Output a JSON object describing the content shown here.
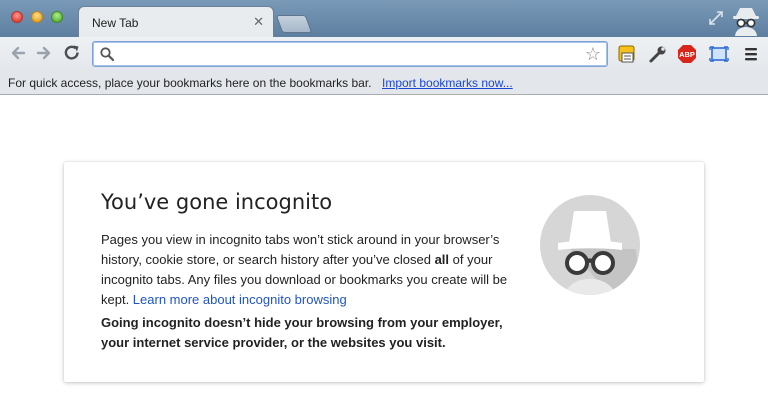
{
  "browser": {
    "tab": {
      "title": "New Tab",
      "close_glyph": "✕"
    },
    "window_controls": [
      "close",
      "minimize",
      "maximize"
    ],
    "icons": {
      "back": "back-arrow-icon",
      "forward": "forward-arrow-icon",
      "reload": "reload-icon",
      "search": "search-icon",
      "star": "bookmark-star-icon",
      "extensions": [
        "rss-extension-icon",
        "wrench-extension-icon",
        "adblock-plus-icon",
        "screenshot-extension-icon",
        "menu-icon"
      ]
    },
    "omnibox": {
      "value": "",
      "placeholder": ""
    },
    "star_glyph": "☆",
    "adblock_label": "ABP"
  },
  "bookmarks_bar": {
    "text": "For quick access, place your bookmarks here on the bookmarks bar.",
    "import_link": "Import bookmarks now..."
  },
  "page": {
    "heading": "You’ve gone incognito",
    "paragraph": {
      "part1": "Pages you view in incognito tabs won’t stick around in your browser’s history, cookie store, or search history after you’ve closed ",
      "bold": "all",
      "part2": " of your incognito tabs. Any files you download or bookmarks you create will be kept. ",
      "link": "Learn more about incognito browsing"
    },
    "warning": "Going incognito doesn’t hide your browsing from your employer, your internet service provider, or the websites you visit."
  },
  "colors": {
    "titlebar": "#5d7e9f",
    "link": "#1f55c7",
    "bookmark_link": "#1a46d6",
    "incognito_circle": "#d6d6d6"
  }
}
